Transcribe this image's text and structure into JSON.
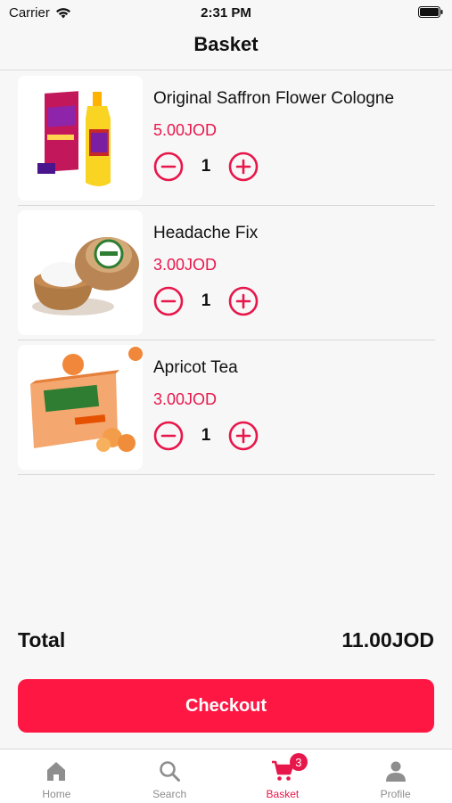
{
  "status": {
    "carrier": "Carrier",
    "time": "2:31 PM"
  },
  "nav": {
    "title": "Basket"
  },
  "items": [
    {
      "name": "Original Saffron Flower Cologne",
      "price": "5.00JOD",
      "qty": "1"
    },
    {
      "name": "Headache Fix",
      "price": "3.00JOD",
      "qty": "1"
    },
    {
      "name": "Apricot Tea",
      "price": "3.00JOD",
      "qty": "1"
    }
  ],
  "summary": {
    "total_label": "Total",
    "total_value": "11.00JOD"
  },
  "checkout_label": "Checkout",
  "tabs": [
    {
      "label": "Home",
      "icon": "home-icon"
    },
    {
      "label": "Search",
      "icon": "search-icon"
    },
    {
      "label": "Basket",
      "icon": "cart-icon",
      "badge": "3",
      "active": true
    },
    {
      "label": "Profile",
      "icon": "person-icon"
    }
  ],
  "colors": {
    "accent": "#e8174b",
    "button": "#ff1744",
    "inactive": "#8e8e8e"
  }
}
